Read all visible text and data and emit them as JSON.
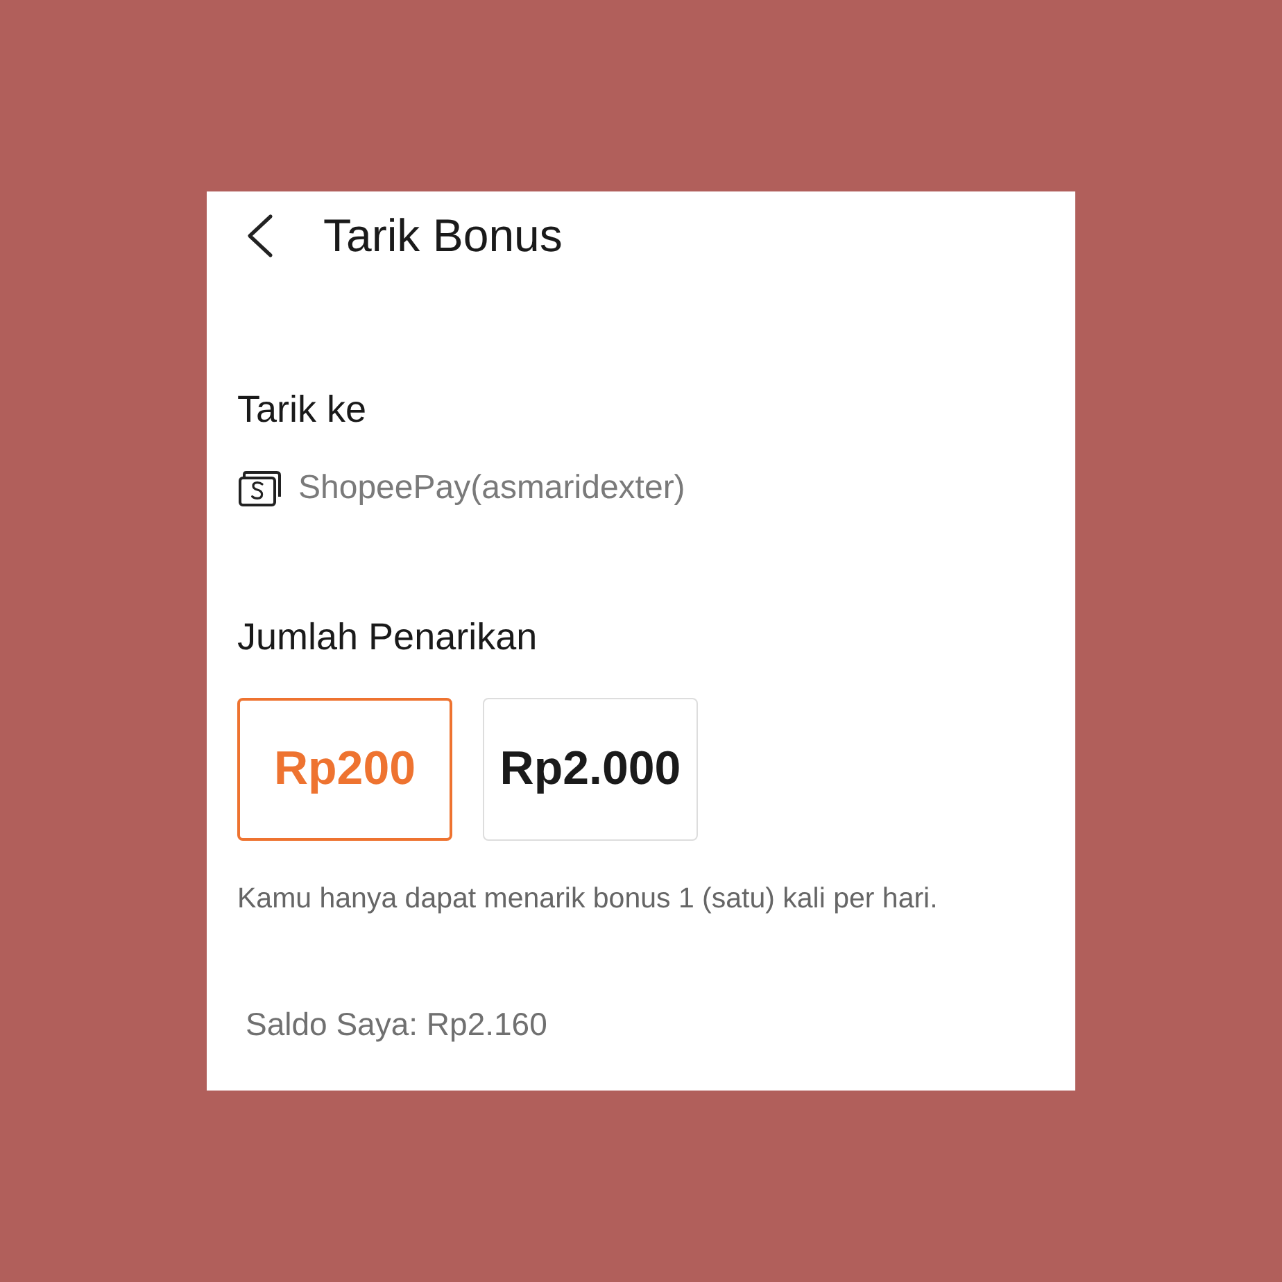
{
  "header": {
    "title": "Tarik Bonus"
  },
  "destination": {
    "label": "Tarik ke",
    "account": "ShopeePay(asmaridexter)"
  },
  "amount": {
    "label": "Jumlah Penarikan",
    "options": [
      {
        "label": "Rp200",
        "selected": true
      },
      {
        "label": "Rp2.000",
        "selected": false
      }
    ],
    "note": "Kamu hanya dapat menarik bonus 1 (satu) kali per hari."
  },
  "balance": "Saldo Saya: Rp2.160"
}
